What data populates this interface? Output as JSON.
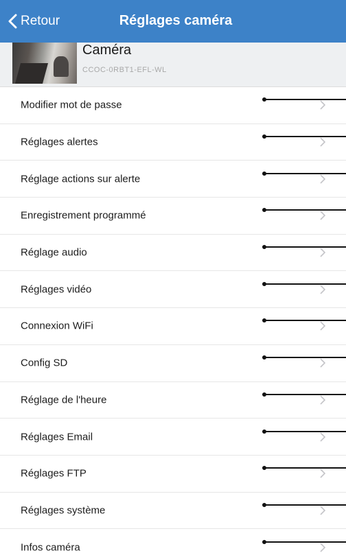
{
  "nav": {
    "back_label": "Retour",
    "title": "Réglages caméra",
    "background_color": "#3d82c8"
  },
  "camera": {
    "name": "Caméra",
    "id": "CCOC-0RBT1-EFL-WL"
  },
  "menu": {
    "items": [
      {
        "label": "Modifier mot de passe"
      },
      {
        "label": "Réglages alertes"
      },
      {
        "label": "Réglage actions sur alerte"
      },
      {
        "label": "Enregistrement programmé"
      },
      {
        "label": "Réglage audio"
      },
      {
        "label": "Réglages vidéo"
      },
      {
        "label": "Connexion WiFi"
      },
      {
        "label": "Config SD"
      },
      {
        "label": "Réglage de l'heure"
      },
      {
        "label": "Réglages Email"
      },
      {
        "label": "Réglages FTP"
      },
      {
        "label": "Réglages système"
      },
      {
        "label": "Infos caméra"
      }
    ]
  },
  "icons": {
    "back": "chevron-left-icon",
    "row_arrow": "chevron-right-icon"
  }
}
